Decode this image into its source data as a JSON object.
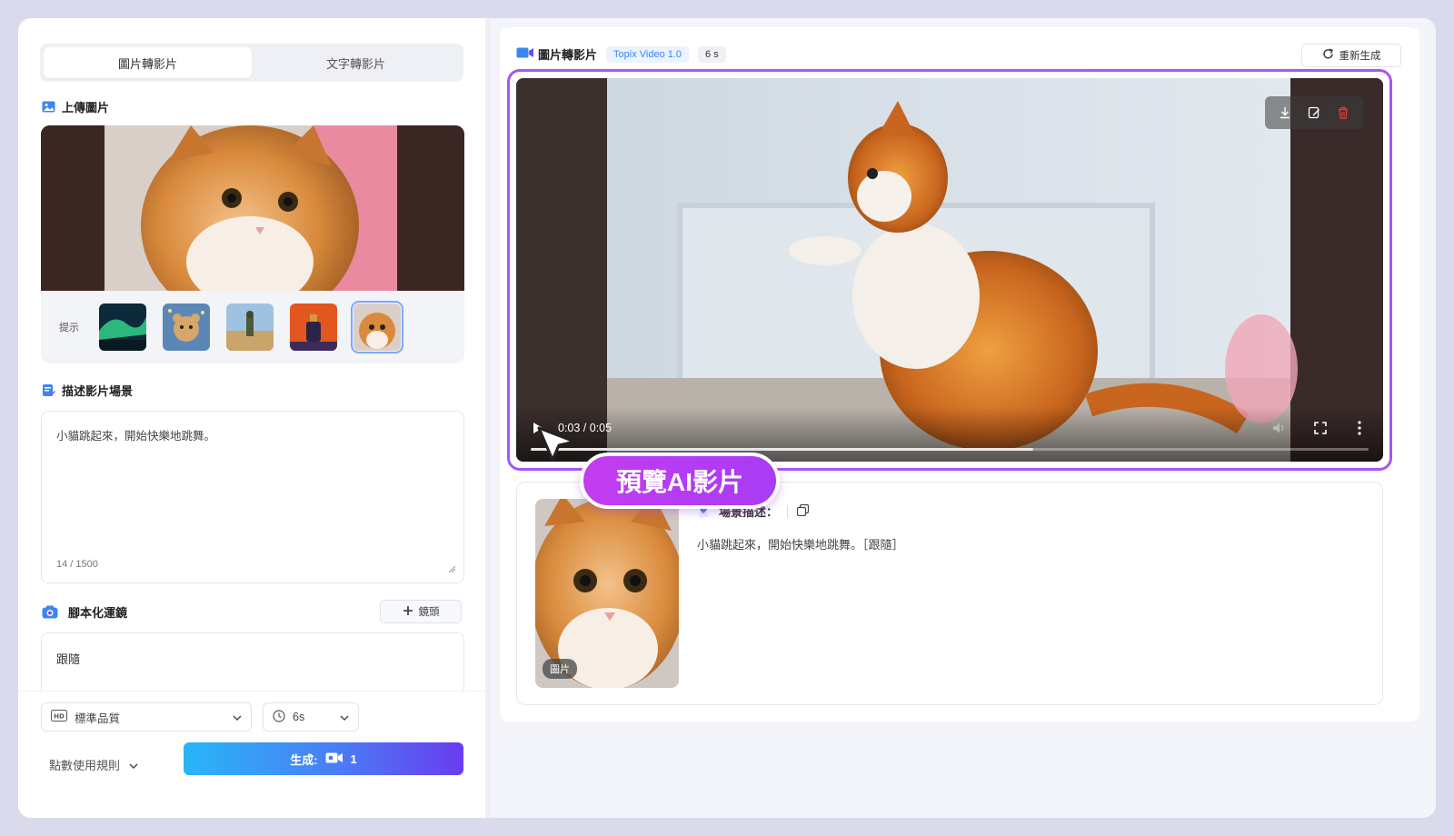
{
  "left": {
    "tabs": [
      "圖片轉影片",
      "文字轉影片"
    ],
    "upload_title": "上傳圖片",
    "hint_label": "提示",
    "thumbnails": [
      "aurora",
      "teddy-bear",
      "soldier-desert",
      "perfume",
      "cat"
    ],
    "desc_title": "描述影片場景",
    "desc_text": "小貓跳起來，開始快樂地跳舞。",
    "desc_count": "14 / 1500",
    "camera_title": "腳本化運鏡",
    "add_shot_label": "鏡頭",
    "camera_value": "跟隨",
    "quality_value": "標準品質",
    "duration_value": "6s",
    "rules_label": "點數使用規則",
    "generate_label": "生成:",
    "generate_cost": "1"
  },
  "right": {
    "title": "圖片轉影片",
    "model_tag": "Topix Video 1.0",
    "duration_tag": "6 s",
    "regen_label": "重新生成",
    "video_time": "0:03 / 0:05",
    "video_progress_fraction": 0.6,
    "preview_label": "預覽AI影片",
    "scene_title": "場景描述：",
    "scene_text": "小貓跳起來，開始快樂地跳舞。［跟隨］",
    "image_badge": "圖片"
  },
  "colors": {
    "accent_purple": "#a855f7",
    "model_tag_blue": "#3a86f0",
    "generate_gradient_start": "#29b6f6",
    "generate_gradient_end": "#6a3cf0",
    "delete_red": "#e53935"
  }
}
